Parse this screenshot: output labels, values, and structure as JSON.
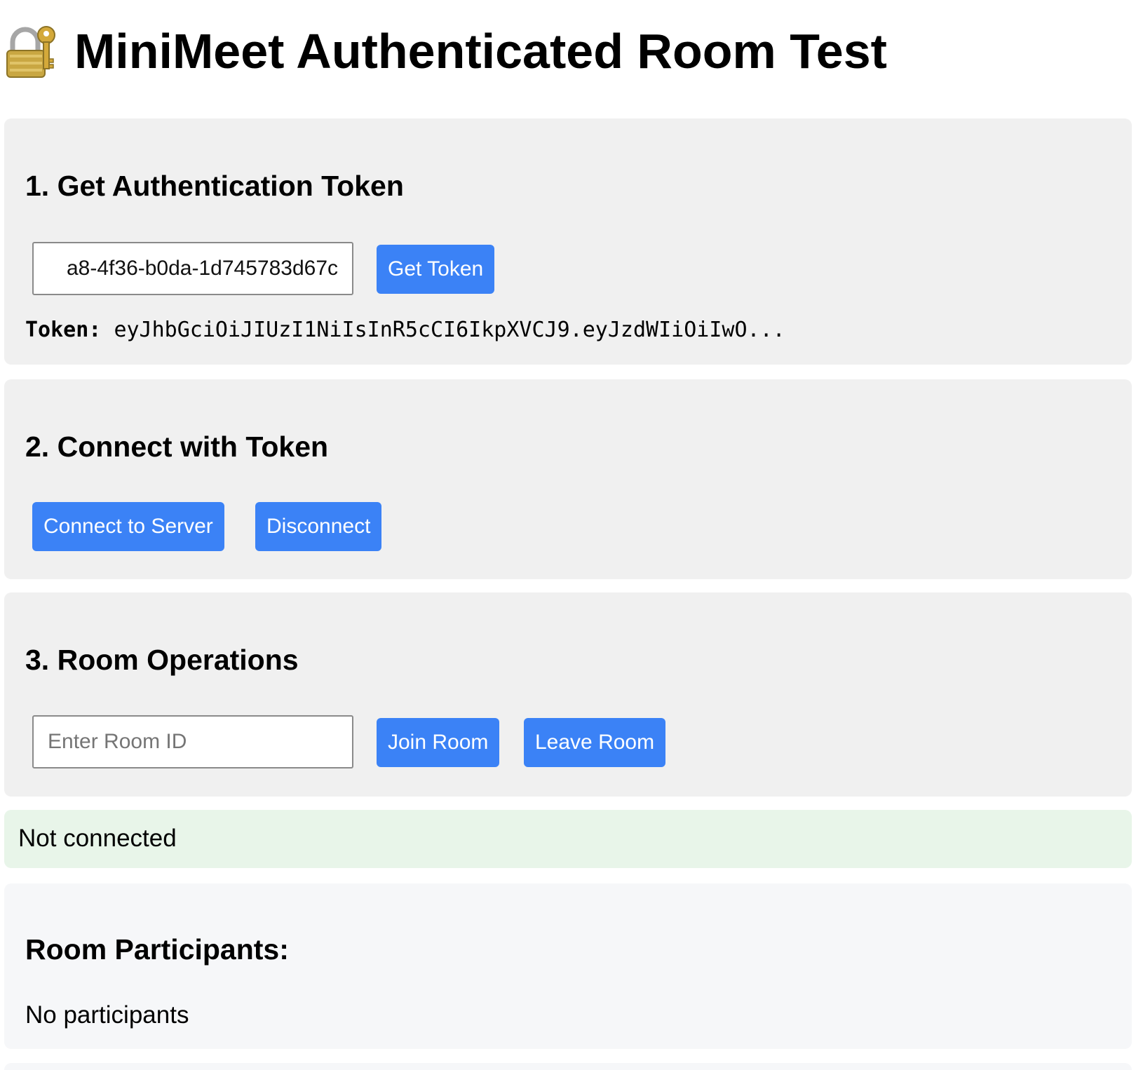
{
  "header": {
    "title": "MiniMeet Authenticated Room Test",
    "icon": "lock-with-key-icon"
  },
  "colors": {
    "accent": "#3b82f6",
    "section_bg": "#f0f0f0",
    "status_bg": "#e8f5e9",
    "participants_bg": "#f6f7f9"
  },
  "auth_section": {
    "heading": "1. Get Authentication Token",
    "user_id_value": "a8-4f36-b0da-1d745783d67c",
    "get_token_label": "Get Token",
    "token_label": "Token:",
    "token_value": "eyJhbGciOiJIUzI1NiIsInR5cCI6IkpXVCJ9.eyJzdWIiOiIwO..."
  },
  "connect_section": {
    "heading": "2. Connect with Token",
    "connect_label": "Connect to Server",
    "disconnect_label": "Disconnect"
  },
  "room_section": {
    "heading": "3. Room Operations",
    "room_id_placeholder": "Enter Room ID",
    "room_id_value": "",
    "join_label": "Join Room",
    "leave_label": "Leave Room"
  },
  "status": {
    "text": "Not connected"
  },
  "participants": {
    "heading": "Room Participants:",
    "empty_text": "No participants"
  }
}
